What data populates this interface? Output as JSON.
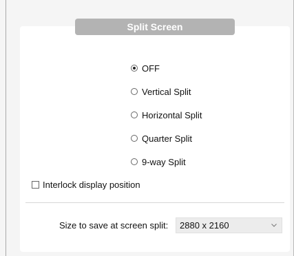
{
  "section": {
    "title": "Split Screen"
  },
  "split_options": [
    {
      "label": "OFF",
      "checked": true
    },
    {
      "label": "Vertical Split",
      "checked": false
    },
    {
      "label": "Horizontal Split",
      "checked": false
    },
    {
      "label": "Quarter Split",
      "checked": false
    },
    {
      "label": "9-way Split",
      "checked": false
    }
  ],
  "interlock": {
    "label": "Interlock display position",
    "checked": false
  },
  "size": {
    "label": "Size to save at screen split:",
    "value": "2880 x 2160"
  },
  "colors": {
    "header_bg": "#b3b3b3",
    "panel_bg": "#ffffff",
    "page_bg": "#f5f5f5"
  }
}
